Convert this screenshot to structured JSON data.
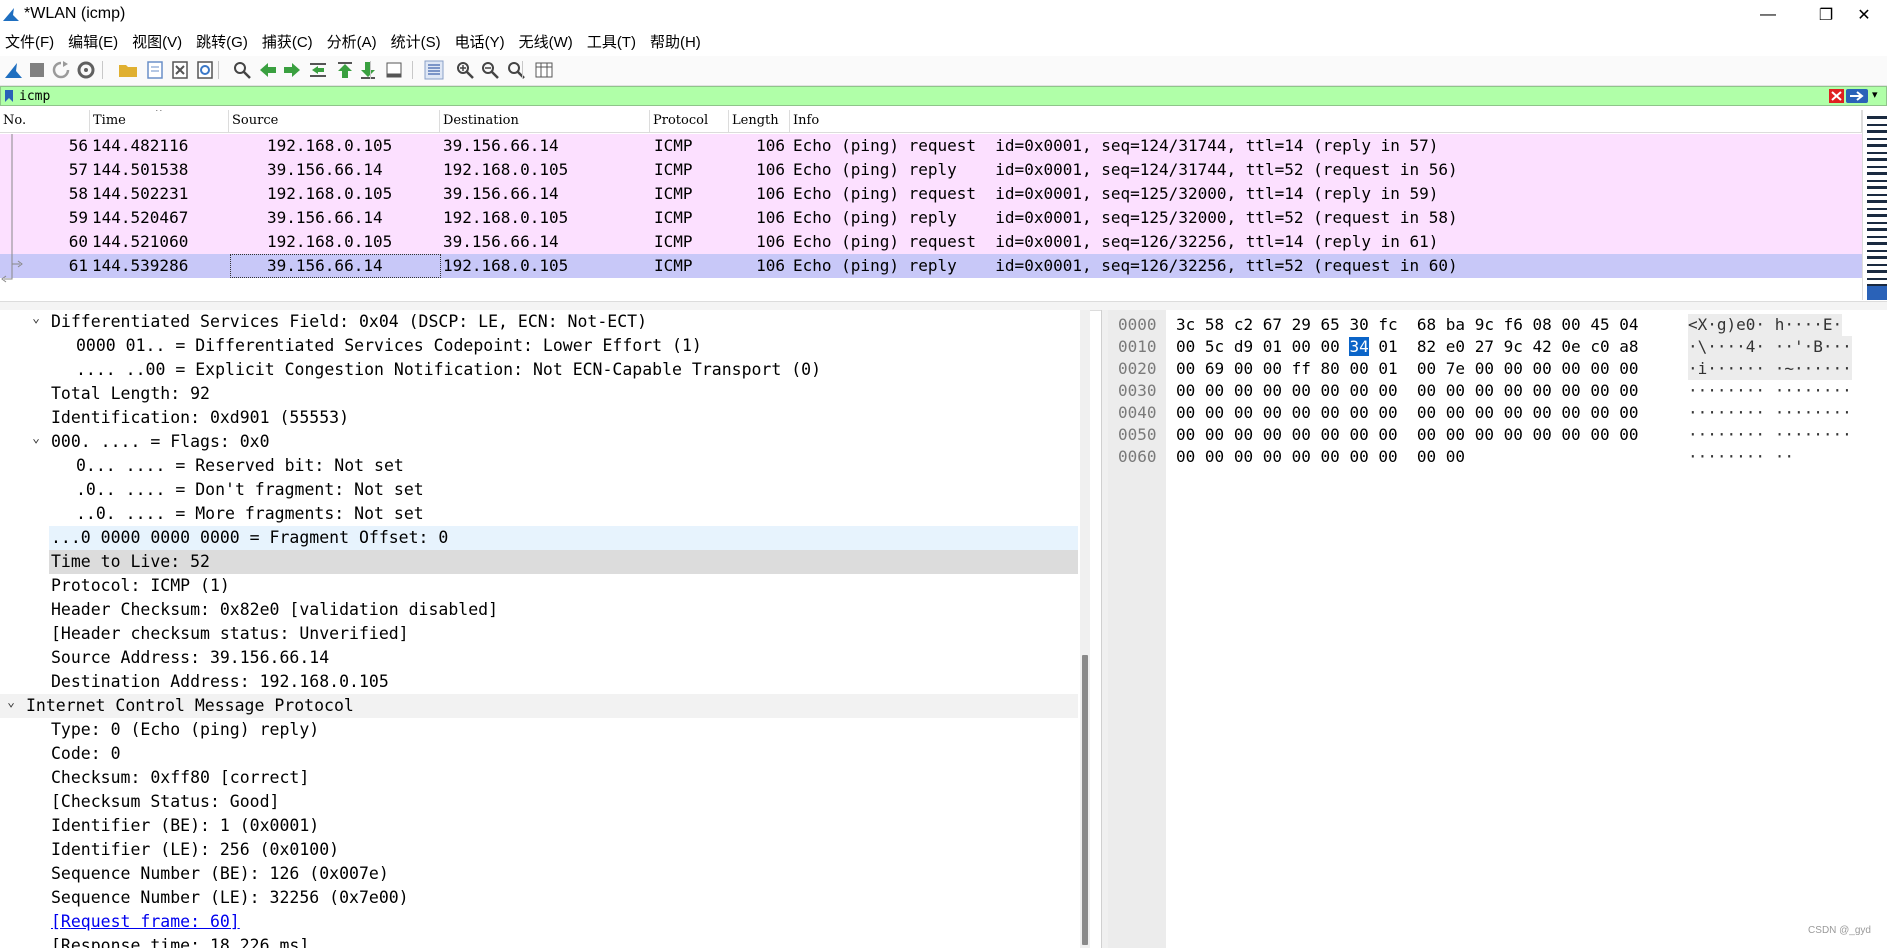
{
  "window": {
    "title": "*WLAN (icmp)",
    "minimize_glyph": "—",
    "maximize_glyph": "❐",
    "close_glyph": "✕"
  },
  "menu": [
    "文件(F)",
    "编辑(E)",
    "视图(V)",
    "跳转(G)",
    "捕获(C)",
    "分析(A)",
    "统计(S)",
    "电话(Y)",
    "无线(W)",
    "工具(T)",
    "帮助(H)"
  ],
  "toolbar_icons": [
    "shark-fin-start-icon",
    "stop-capture-icon",
    "restart-capture-icon",
    "capture-options-icon",
    "open-file-icon",
    "save-file-icon",
    "close-file-icon",
    "reload-file-icon",
    "find-packet-icon",
    "go-back-icon",
    "go-forward-icon",
    "go-to-packet-icon",
    "first-packet-icon",
    "last-packet-icon",
    "auto-scroll-icon",
    "colorize-icon",
    "zoom-in-icon",
    "zoom-out-icon",
    "zoom-reset-icon",
    "resize-columns-icon"
  ],
  "filter": {
    "value": "icmp"
  },
  "packet_list": {
    "columns": [
      "No.",
      "Time",
      "Source",
      "Destination",
      "Protocol",
      "Length",
      "Info"
    ],
    "rows": [
      {
        "no": "56",
        "time": "144.482116",
        "src": "192.168.0.105",
        "dst": "39.156.66.14",
        "proto": "ICMP",
        "len": "106",
        "info": "Echo (ping) request  id=0x0001, seq=124/31744, ttl=14 (reply in 57)"
      },
      {
        "no": "57",
        "time": "144.501538",
        "src": "39.156.66.14",
        "dst": "192.168.0.105",
        "proto": "ICMP",
        "len": "106",
        "info": "Echo (ping) reply    id=0x0001, seq=124/31744, ttl=52 (request in 56)"
      },
      {
        "no": "58",
        "time": "144.502231",
        "src": "192.168.0.105",
        "dst": "39.156.66.14",
        "proto": "ICMP",
        "len": "106",
        "info": "Echo (ping) request  id=0x0001, seq=125/32000, ttl=14 (reply in 59)"
      },
      {
        "no": "59",
        "time": "144.520467",
        "src": "39.156.66.14",
        "dst": "192.168.0.105",
        "proto": "ICMP",
        "len": "106",
        "info": "Echo (ping) reply    id=0x0001, seq=125/32000, ttl=52 (request in 58)"
      },
      {
        "no": "60",
        "time": "144.521060",
        "src": "192.168.0.105",
        "dst": "39.156.66.14",
        "proto": "ICMP",
        "len": "106",
        "info": "Echo (ping) request  id=0x0001, seq=126/32256, ttl=14 (reply in 61)"
      },
      {
        "no": "61",
        "time": "144.539286",
        "src": "39.156.66.14",
        "dst": "192.168.0.105",
        "proto": "ICMP",
        "len": "106",
        "info": "Echo (ping) reply    id=0x0001, seq=126/32256, ttl=52 (request in 60)"
      }
    ],
    "selected_row": "61"
  },
  "details": [
    {
      "text": "Differentiated Services Field: 0x04 (DSCP: LE, ECN: Not-ECT)",
      "expander": "open",
      "level": 1,
      "hl": ""
    },
    {
      "text": "0000 01.. = Differentiated Services Codepoint: Lower Effort (1)",
      "expander": "",
      "level": 2,
      "hl": ""
    },
    {
      "text": ".... ..00 = Explicit Congestion Notification: Not ECN-Capable Transport (0)",
      "expander": "",
      "level": 2,
      "hl": ""
    },
    {
      "text": "Total Length: 92",
      "expander": "",
      "level": 1,
      "hl": ""
    },
    {
      "text": "Identification: 0xd901 (55553)",
      "expander": "",
      "level": 1,
      "hl": ""
    },
    {
      "text": "000. .... = Flags: 0x0",
      "expander": "open",
      "level": 1,
      "hl": ""
    },
    {
      "text": "0... .... = Reserved bit: Not set",
      "expander": "",
      "level": 2,
      "hl": ""
    },
    {
      "text": ".0.. .... = Don't fragment: Not set",
      "expander": "",
      "level": 2,
      "hl": ""
    },
    {
      "text": "..0. .... = More fragments: Not set",
      "expander": "",
      "level": 2,
      "hl": ""
    },
    {
      "text": "...0 0000 0000 0000 = Fragment Offset: 0",
      "expander": "",
      "level": 1,
      "hl": "blue"
    },
    {
      "text": "Time to Live: 52",
      "expander": "",
      "level": 1,
      "hl": "grey"
    },
    {
      "text": "Protocol: ICMP (1)",
      "expander": "",
      "level": 1,
      "hl": ""
    },
    {
      "text": "Header Checksum: 0x82e0 [validation disabled]",
      "expander": "",
      "level": 1,
      "hl": ""
    },
    {
      "text": "[Header checksum status: Unverified]",
      "expander": "",
      "level": 1,
      "hl": ""
    },
    {
      "text": "Source Address: 39.156.66.14",
      "expander": "",
      "level": 1,
      "hl": ""
    },
    {
      "text": "Destination Address: 192.168.0.105",
      "expander": "",
      "level": 1,
      "hl": ""
    },
    {
      "text": "Internet Control Message Protocol",
      "expander": "open",
      "level": 0,
      "hl": "sect"
    },
    {
      "text": "Type: 0 (Echo (ping) reply)",
      "expander": "",
      "level": 1,
      "hl": ""
    },
    {
      "text": "Code: 0",
      "expander": "",
      "level": 1,
      "hl": ""
    },
    {
      "text": "Checksum: 0xff80 [correct]",
      "expander": "",
      "level": 1,
      "hl": ""
    },
    {
      "text": "[Checksum Status: Good]",
      "expander": "",
      "level": 1,
      "hl": ""
    },
    {
      "text": "Identifier (BE): 1 (0x0001)",
      "expander": "",
      "level": 1,
      "hl": ""
    },
    {
      "text": "Identifier (LE): 256 (0x0100)",
      "expander": "",
      "level": 1,
      "hl": ""
    },
    {
      "text": "Sequence Number (BE): 126 (0x007e)",
      "expander": "",
      "level": 1,
      "hl": ""
    },
    {
      "text": "Sequence Number (LE): 32256 (0x7e00)",
      "expander": "",
      "level": 1,
      "hl": ""
    },
    {
      "text": "[Request frame: 60]",
      "expander": "",
      "level": 1,
      "hl": "link"
    },
    {
      "text": "[Response time: 18.226 ms]",
      "expander": "",
      "level": 1,
      "hl": ""
    }
  ],
  "bytes": [
    {
      "offset": "0000",
      "hex": [
        "3c",
        "58",
        "c2",
        "67",
        "29",
        "65",
        "30",
        "fc",
        "68",
        "ba",
        "9c",
        "f6",
        "08",
        "00",
        "45",
        "04"
      ],
      "ascii": "<X·g)e0· h····E·"
    },
    {
      "offset": "0010",
      "hex": [
        "00",
        "5c",
        "d9",
        "01",
        "00",
        "00",
        "34",
        "01",
        "82",
        "e0",
        "27",
        "9c",
        "42",
        "0e",
        "c0",
        "a8"
      ],
      "ascii": "·\\····4· ··'·B···"
    },
    {
      "offset": "0020",
      "hex": [
        "00",
        "69",
        "00",
        "00",
        "ff",
        "80",
        "00",
        "01",
        "00",
        "7e",
        "00",
        "00",
        "00",
        "00",
        "00",
        "00"
      ],
      "ascii": "·i······ ·~······"
    },
    {
      "offset": "0030",
      "hex": [
        "00",
        "00",
        "00",
        "00",
        "00",
        "00",
        "00",
        "00",
        "00",
        "00",
        "00",
        "00",
        "00",
        "00",
        "00",
        "00"
      ],
      "ascii": "········ ········"
    },
    {
      "offset": "0040",
      "hex": [
        "00",
        "00",
        "00",
        "00",
        "00",
        "00",
        "00",
        "00",
        "00",
        "00",
        "00",
        "00",
        "00",
        "00",
        "00",
        "00"
      ],
      "ascii": "········ ········"
    },
    {
      "offset": "0050",
      "hex": [
        "00",
        "00",
        "00",
        "00",
        "00",
        "00",
        "00",
        "00",
        "00",
        "00",
        "00",
        "00",
        "00",
        "00",
        "00",
        "00"
      ],
      "ascii": "········ ········"
    },
    {
      "offset": "0060",
      "hex": [
        "00",
        "00",
        "00",
        "00",
        "00",
        "00",
        "00",
        "00",
        "00",
        "00"
      ],
      "ascii": "········ ··"
    }
  ],
  "bytes_selected": {
    "row": 1,
    "col": 6
  },
  "watermark": "CSDN @_gyd"
}
